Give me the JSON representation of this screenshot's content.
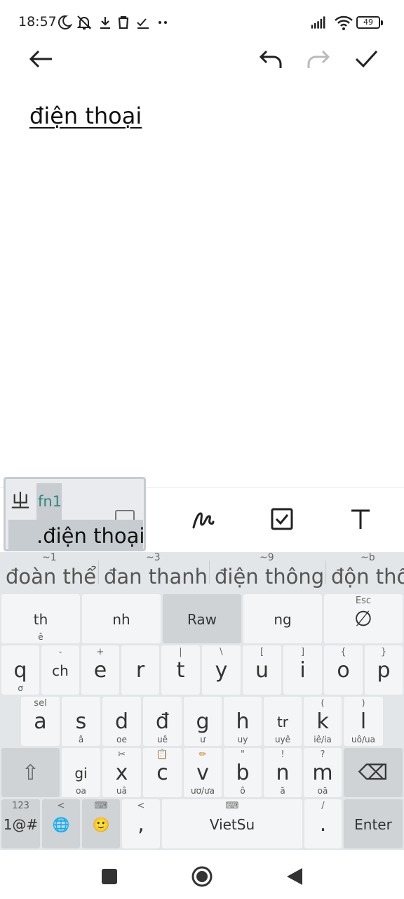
{
  "status": {
    "time": "18:57",
    "battery": "49"
  },
  "note": {
    "text": "điện thoại"
  },
  "popup": {
    "symbol": "ㄓ",
    "fn_label": "fn1",
    "word": ".điện thoại"
  },
  "suggestions": [
    {
      "hint": "~1",
      "word": "đoàn thể"
    },
    {
      "hint": "~3",
      "word": "đan thanh"
    },
    {
      "hint": "~9",
      "word": "điện thông"
    },
    {
      "hint": "~b",
      "word": "độn thổ"
    }
  ],
  "keys": {
    "row0": [
      {
        "main": "th",
        "top": "",
        "bot": "ê"
      },
      {
        "main": "nh",
        "top": "",
        "bot": ""
      },
      {
        "main": "Raw",
        "top": "",
        "bot": ""
      },
      {
        "main": "ng",
        "top": "",
        "bot": ""
      },
      {
        "main": "∅",
        "top": "Esc",
        "bot": ""
      }
    ],
    "row1": [
      {
        "main": "q",
        "top": "",
        "bot": "ơ"
      },
      {
        "main": "ch",
        "top": "-",
        "bot": ""
      },
      {
        "main": "e",
        "top": "+",
        "bot": ""
      },
      {
        "main": "r",
        "top": "",
        "bot": ""
      },
      {
        "main": "t",
        "top": "|",
        "bot": ""
      },
      {
        "main": "y",
        "top": "\\",
        "bot": ""
      },
      {
        "main": "u",
        "top": "[",
        "bot": ""
      },
      {
        "main": "i",
        "top": "]",
        "bot": ""
      },
      {
        "main": "o",
        "top": "{",
        "bot": ""
      },
      {
        "main": "p",
        "top": "}",
        "bot": ""
      }
    ],
    "row2": [
      {
        "main": "a",
        "top": "sel",
        "bot": ""
      },
      {
        "main": "s",
        "top": "",
        "bot": "â"
      },
      {
        "main": "d",
        "top": "",
        "bot": "oe"
      },
      {
        "main": "đ",
        "top": "",
        "bot": "uê"
      },
      {
        "main": "g",
        "top": "",
        "bot": "ư"
      },
      {
        "main": "h",
        "top": "",
        "bot": "uy"
      },
      {
        "main": "tr",
        "top": "",
        "bot": "uyê"
      },
      {
        "main": "k",
        "top": "(",
        "bot": "iê/ia"
      },
      {
        "main": "l",
        "top": ")",
        "bot": "uô/ua"
      }
    ],
    "row3": [
      {
        "main": "⇧",
        "top": "",
        "bot": ""
      },
      {
        "main": "gi",
        "top": "",
        "bot": "oa"
      },
      {
        "main": "x",
        "top": "✂",
        "bot": "uâ"
      },
      {
        "main": "c",
        "top": "📋",
        "bot": ""
      },
      {
        "main": "v",
        "top": "✏",
        "bot": "ươ/ưa"
      },
      {
        "main": "b",
        "top": "\"",
        "bot": "ô"
      },
      {
        "main": "n",
        "top": "!",
        "bot": "ă"
      },
      {
        "main": "m",
        "top": "?",
        "bot": "oă"
      },
      {
        "main": "⌫",
        "top": "",
        "bot": ""
      }
    ],
    "row4": [
      {
        "main": "1@#",
        "top": "123",
        "bot": ""
      },
      {
        "main": "🌐",
        "top": "<",
        "bot": ""
      },
      {
        "main": "🙂",
        "top": "⌨",
        "bot": ""
      },
      {
        "main": ",",
        "top": "<",
        "bot": ""
      },
      {
        "main": "VietSu",
        "top": "⌨",
        "bot": ""
      },
      {
        "main": ".",
        "top": "/",
        "bot": ""
      },
      {
        "main": "Enter",
        "top": "",
        "bot": ""
      }
    ]
  },
  "colors": {
    "keyboard_bg": "#e3e6e9",
    "key": "#f3f5f6",
    "key_dark": "#cfd3d6",
    "fn_teal": "#2a8a7f"
  }
}
